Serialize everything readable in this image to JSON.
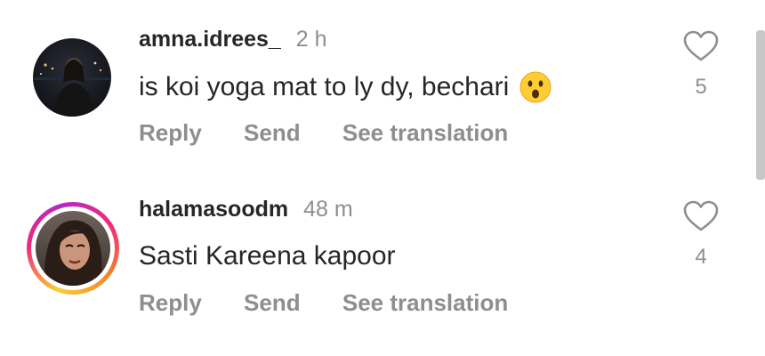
{
  "comments": [
    {
      "username": "amna.idrees_",
      "time": "2 h",
      "text": "is koi yoga mat to ly dy, bechari",
      "emoji": "hushed-face-emoji",
      "likes": "5",
      "actions": {
        "reply": "Reply",
        "send": "Send",
        "translate": "See translation"
      }
    },
    {
      "username": "halamasoodm",
      "time": "48 m",
      "text": "Sasti Kareena kapoor",
      "likes": "4",
      "story_ring": true,
      "actions": {
        "reply": "Reply",
        "send": "Send",
        "translate": "See translation"
      }
    }
  ],
  "icons": {
    "like": "heart-outline-icon"
  },
  "colors": {
    "text_primary": "#262626",
    "text_secondary": "#8e8e8e",
    "story_ring_start": "#f9ce34",
    "story_ring_end": "#ee2a7b"
  }
}
